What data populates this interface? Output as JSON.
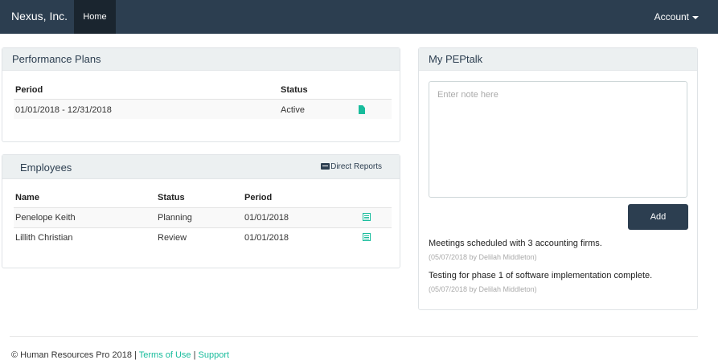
{
  "navbar": {
    "brand": "Nexus, Inc.",
    "home_label": "Home",
    "account_label": "Account"
  },
  "performance_plans": {
    "title": "Performance Plans",
    "columns": [
      "Period",
      "Status"
    ],
    "rows": [
      {
        "period": "01/01/2018 - 12/31/2018",
        "status": "Active",
        "icon": "file-icon"
      }
    ]
  },
  "employees": {
    "title": "Employees",
    "direct_reports_label": "Direct Reports",
    "columns": [
      "Name",
      "Status",
      "Period"
    ],
    "rows": [
      {
        "name": "Penelope Keith",
        "status": "Planning",
        "period": "01/01/2018",
        "icon": "list-icon"
      },
      {
        "name": "Lillith Christian",
        "status": "Review",
        "period": "01/01/2018",
        "icon": "list-icon"
      }
    ]
  },
  "peptalk": {
    "title": "My PEPtalk",
    "note_placeholder": "Enter note here",
    "add_label": "Add",
    "notes": [
      {
        "text": "Meetings scheduled with 3 accounting firms.",
        "meta": "(05/07/2018 by Delilah Middleton)"
      },
      {
        "text": "Testing for phase 1 of software implementation complete.",
        "meta": "(05/07/2018 by Delilah Middleton)"
      }
    ]
  },
  "footer": {
    "copyright": "© Human Resources Pro 2018",
    "separator": "|",
    "terms_label": "Terms of Use",
    "support_label": "Support"
  },
  "colors": {
    "navbar": "#2c3e50",
    "accent": "#18bc9c",
    "panel_header": "#ecf0f1"
  }
}
